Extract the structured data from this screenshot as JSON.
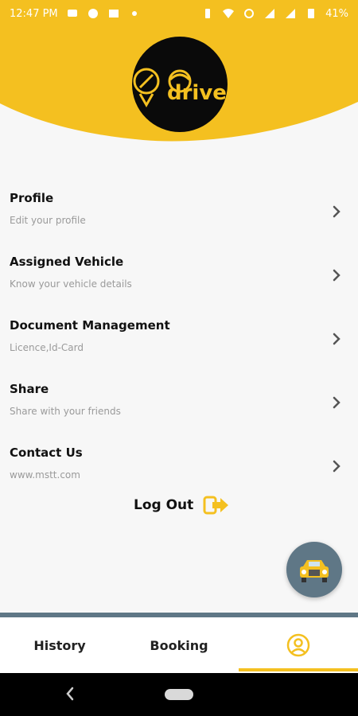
{
  "status_bar": {
    "time": "12:47 PM",
    "battery": "41%"
  },
  "colors": {
    "accent": "#f4c020",
    "fab": "#5f7786",
    "muted": "#9a9a9a"
  },
  "logo": {
    "text": "driver"
  },
  "menu": {
    "items": [
      {
        "title": "Profile",
        "subtitle": "Edit your profile"
      },
      {
        "title": "Assigned Vehicle",
        "subtitle": "Know your vehicle details"
      },
      {
        "title": "Document Management",
        "subtitle": "Licence,Id-Card"
      },
      {
        "title": "Share",
        "subtitle": "Share with your friends"
      },
      {
        "title": "Contact Us",
        "subtitle": "www.mstt.com"
      }
    ]
  },
  "logout": {
    "label": "Log Out"
  },
  "tabs": [
    {
      "label": "History"
    },
    {
      "label": "Booking"
    },
    {
      "label": "",
      "icon": "account-circle-icon"
    }
  ]
}
